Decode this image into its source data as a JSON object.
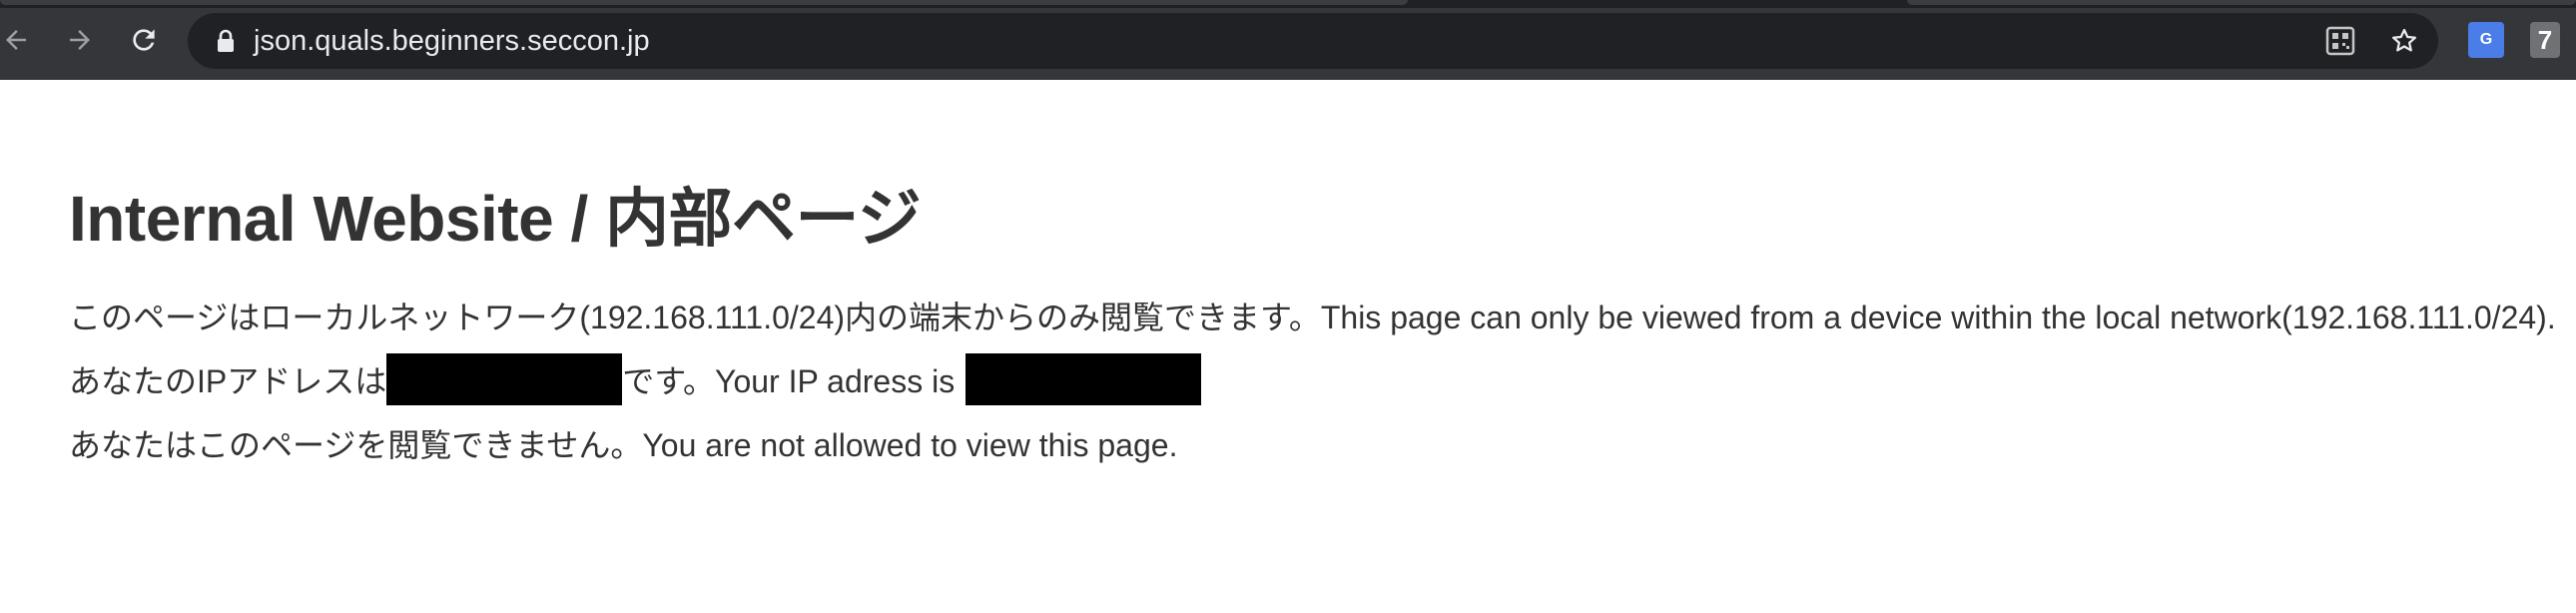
{
  "browser": {
    "url": "json.quals.beginners.seccon.jp",
    "extension_badge": "7",
    "translate_label": "G",
    "icons": {
      "back": "back-arrow-icon",
      "forward": "forward-arrow-icon",
      "reload": "reload-icon",
      "lock": "lock-icon",
      "qr": "qr-code-icon",
      "bookmark": "star-icon",
      "translate": "google-translate-icon"
    }
  },
  "page": {
    "title": "Internal Website / 内部ページ",
    "line1": "このページはローカルネットワーク(192.168.111.0/24)内の端末からのみ閲覧できます。This page can only be viewed from a device within the local network(192.168.111.0/24).",
    "line2_prefix": "あなたのIPアドレスは",
    "line2_middle": "です。Your IP adress is ",
    "line3": "あなたはこのページを閲覧できません。You are not allowed to view this page."
  },
  "colors": {
    "toolbar": "#35363a",
    "omnibox": "#202124",
    "text": "#333333",
    "redaction": "#000000"
  }
}
